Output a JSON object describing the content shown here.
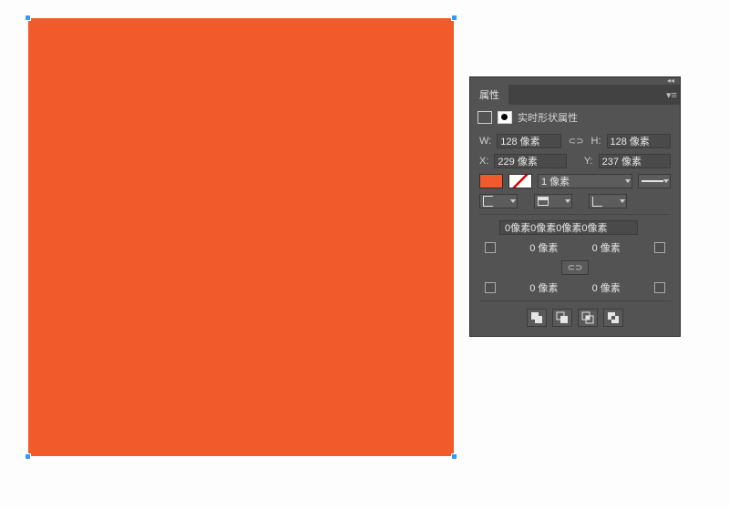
{
  "canvas": {
    "shape_fill": "#f15a2b"
  },
  "panel": {
    "tab_label": "属性",
    "section_title": "实时形状属性",
    "dim": {
      "w_label": "W:",
      "w_value": "128 像素",
      "h_label": "H:",
      "h_value": "128 像素",
      "x_label": "X:",
      "x_value": "229 像素",
      "y_label": "Y:",
      "y_value": "237 像素"
    },
    "stroke": {
      "fill_color": "#f15a2b",
      "weight": "1 像素",
      "cap_value": "",
      "align_value": "",
      "style_value": ""
    },
    "corners": {
      "summary": "0像素0像素0像素0像素",
      "tl": "0 像素",
      "tr": "0 像素",
      "bl": "0 像素",
      "br": "0 像素"
    }
  }
}
